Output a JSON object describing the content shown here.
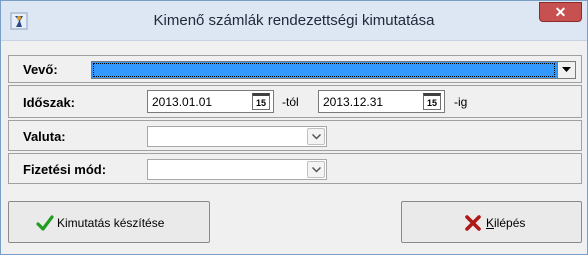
{
  "window": {
    "title": "Kimenő számlák rendezettségi kimutatása",
    "close_glyph": "✕"
  },
  "form": {
    "buyer": {
      "label": "Vevő:",
      "value": ""
    },
    "period": {
      "label": "Időszak:",
      "from": "2013.01.01",
      "from_suffix": "-tól",
      "to": "2013.12.31",
      "to_suffix": "-ig",
      "calendar_glyph": "15"
    },
    "currency": {
      "label": "Valuta:",
      "value": ""
    },
    "payment_method": {
      "label": "Fizetési mód:",
      "value": ""
    }
  },
  "buttons": {
    "run": {
      "label": "Kimutatás készítése",
      "icon": "check-icon"
    },
    "exit": {
      "label_first": "K",
      "label_rest": "ilépés",
      "icon": "x-icon"
    }
  },
  "colors": {
    "selection": "#3399ff",
    "titlebar": "#dde7f3",
    "close": "#c75050",
    "check": "#1f9e1f",
    "exit": "#b01818"
  }
}
